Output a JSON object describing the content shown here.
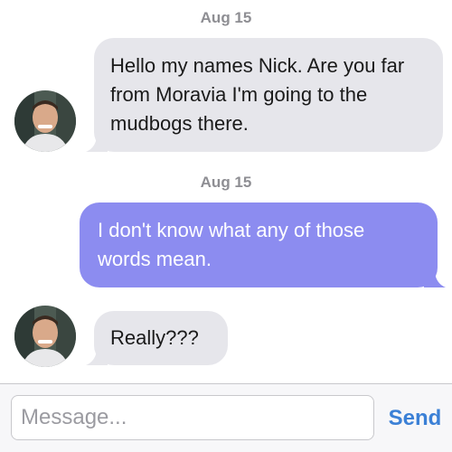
{
  "conversation": {
    "messages": [
      {
        "date": "Aug 15",
        "text": "Hello my names Nick. Are you far from Moravia I'm going to the mudbogs there."
      },
      {
        "date": "Aug 15",
        "text": "I don't know what any of those words mean."
      },
      {
        "text": "Really???"
      }
    ]
  },
  "composer": {
    "placeholder": "Message...",
    "send_label": "Send"
  },
  "colors": {
    "incoming_bubble": "#e6e6eb",
    "outgoing_bubble": "#8c8cf0",
    "send_accent": "#3b80d6",
    "date_text": "#8e8e93"
  }
}
